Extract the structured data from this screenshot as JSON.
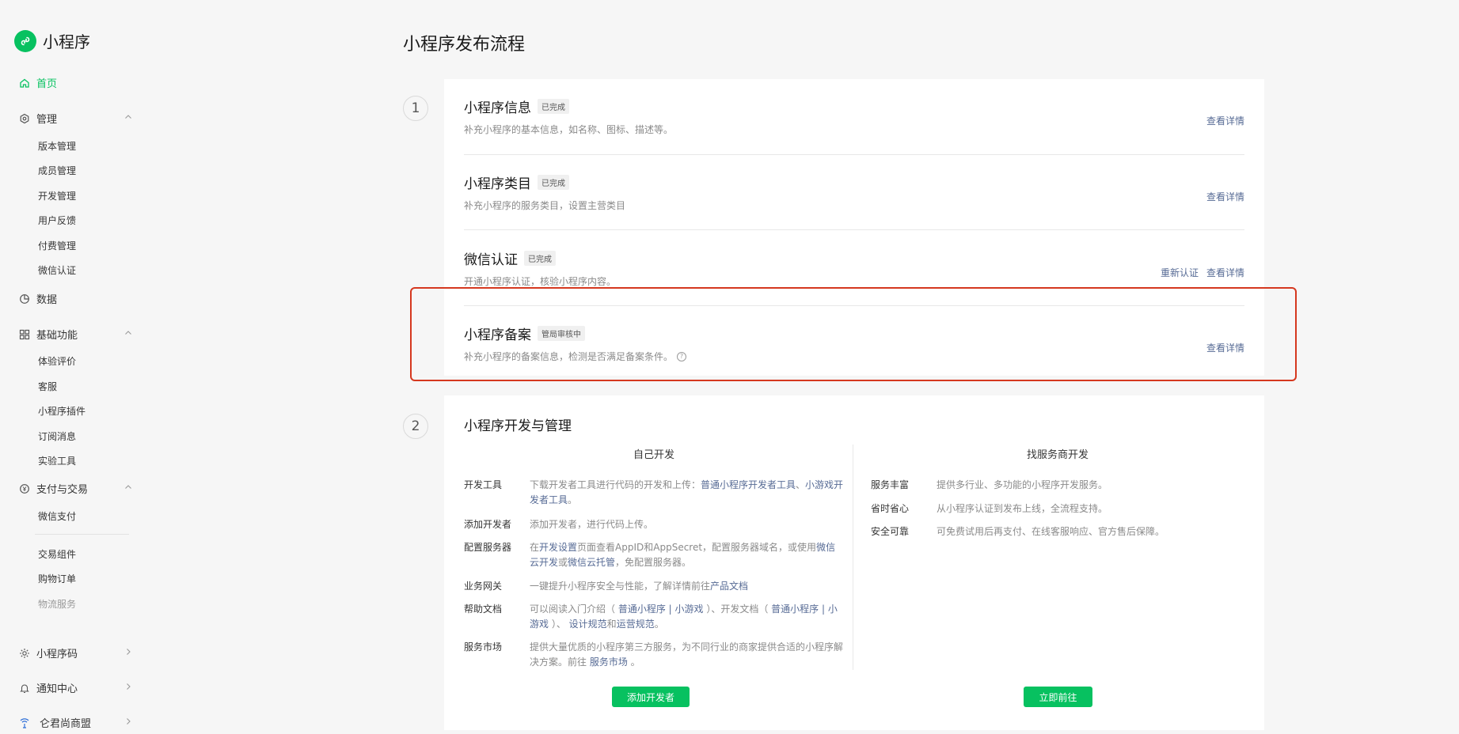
{
  "app": {
    "logo_text": "小程序",
    "accent": "#07c160",
    "link_color": "#576b95"
  },
  "sidebar": {
    "home": {
      "label": "首页",
      "icon": "home-icon"
    },
    "manage": {
      "label": "管理",
      "icon": "settings-hex-icon",
      "items": [
        "版本管理",
        "成员管理",
        "开发管理",
        "用户反馈",
        "付费管理",
        "微信认证"
      ]
    },
    "data": {
      "label": "数据",
      "icon": "pie-chart-icon"
    },
    "basic": {
      "label": "基础功能",
      "icon": "grid-icon",
      "items": [
        "体验评价",
        "客服",
        "小程序插件",
        "订阅消息",
        "实验工具"
      ]
    },
    "pay": {
      "label": "支付与交易",
      "icon": "yuan-icon",
      "items": [
        "微信支付",
        "交易组件",
        "购物订单",
        "物流服务"
      ]
    },
    "qrcode": {
      "label": "小程序码",
      "icon": "sun-icon"
    },
    "notify": {
      "label": "通知中心",
      "icon": "bell-icon"
    },
    "alliance": {
      "label": "仑君尚商盟",
      "icon": "signal-icon"
    }
  },
  "page": {
    "title": "小程序发布流程"
  },
  "step1": {
    "num": "1",
    "rows": [
      {
        "title": "小程序信息",
        "badge": "已完成",
        "desc": "补充小程序的基本信息，如名称、图标、描述等。",
        "actions": [
          "查看详情"
        ]
      },
      {
        "title": "小程序类目",
        "badge": "已完成",
        "desc": "补充小程序的服务类目，设置主营类目",
        "actions": [
          "查看详情"
        ]
      },
      {
        "title": "微信认证",
        "badge": "已完成",
        "desc": "开通小程序认证，核验小程序内容。",
        "actions": [
          "重新认证",
          "查看详情"
        ]
      },
      {
        "title": "小程序备案",
        "badge": "管局审核中",
        "desc": "补充小程序的备案信息，检测是否满足备案条件。",
        "actions": [
          "查看详情"
        ]
      }
    ]
  },
  "step2": {
    "num": "2",
    "title": "小程序开发与管理",
    "self": {
      "head": "自己开发",
      "rows": [
        {
          "label": "开发工具",
          "t1": "下载开发者工具进行代码的开发和上传：",
          "l1": "普通小程序开发者工具",
          "t2": "、",
          "l2": "小游戏开发者工具",
          "t3": "。"
        },
        {
          "label": "添加开发者",
          "t1": "添加开发者，进行代码上传。"
        },
        {
          "label": "配置服务器",
          "t1": "在",
          "l1": "开发设置",
          "t2": "页面查看AppID和AppSecret，配置服务器域名，或使用",
          "l2": "微信云开发",
          "t3": "或",
          "l3": "微信云托管",
          "t4": "，免配置服务器。"
        },
        {
          "label": "业务网关",
          "t1": "一键提升小程序安全与性能，了解详情前往",
          "l1": "产品文档"
        },
        {
          "label": "帮助文档",
          "t1": "可以阅读入门介绍（ ",
          "l1": "普通小程序",
          "t2": " | ",
          "l2": "小游戏",
          "t3": " ）、开发文档（ ",
          "l3": "普通小程序",
          "t4": " | ",
          "l4": "小游戏",
          "t5": " ）、 ",
          "l5": "设计规范",
          "t6": "和",
          "l6": "运营规范",
          "t7": "。"
        },
        {
          "label": "服务市场",
          "t1": "提供大量优质的小程序第三方服务，为不同行业的商家提供合适的小程序解决方案。前往 ",
          "l1": "服务市场",
          "t2": " 。"
        }
      ],
      "button": "添加开发者"
    },
    "vendor": {
      "head": "找服务商开发",
      "rows": [
        {
          "label": "服务丰富",
          "text": "提供多行业、多功能的小程序开发服务。"
        },
        {
          "label": "省时省心",
          "text": "从小程序认证到发布上线，全流程支持。"
        },
        {
          "label": "安全可靠",
          "text": "可免费试用后再支付、在线客服响应、官方售后保障。"
        }
      ],
      "button": "立即前往"
    }
  }
}
